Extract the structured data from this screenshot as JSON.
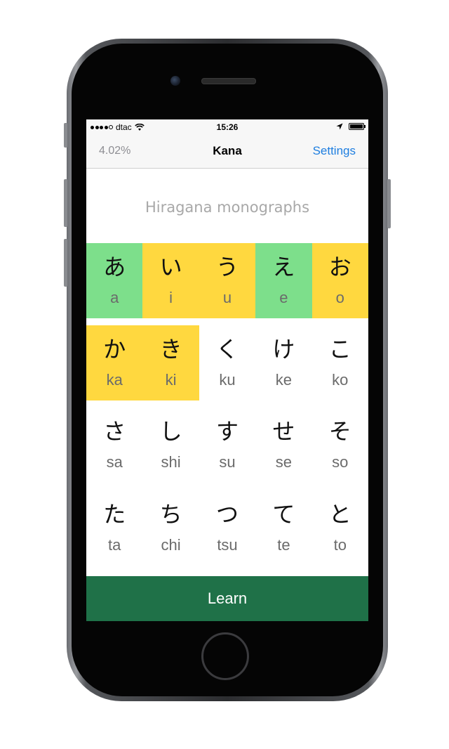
{
  "status_bar": {
    "carrier": "dtac",
    "time": "15:26"
  },
  "nav": {
    "progress": "4.02%",
    "title": "Kana",
    "settings_label": "Settings"
  },
  "section_title": "Hiragana monographs",
  "colors": {
    "known": "#7ddf8b",
    "learning": "#ffd83f",
    "learn_button": "#1f7148",
    "link": "#1e7ee0"
  },
  "rows": [
    [
      {
        "kana": "あ",
        "romaji": "a",
        "state": "green"
      },
      {
        "kana": "い",
        "romaji": "i",
        "state": "yellow"
      },
      {
        "kana": "う",
        "romaji": "u",
        "state": "yellow"
      },
      {
        "kana": "え",
        "romaji": "e",
        "state": "green"
      },
      {
        "kana": "お",
        "romaji": "o",
        "state": "yellow"
      }
    ],
    [
      {
        "kana": "か",
        "romaji": "ka",
        "state": "yellow"
      },
      {
        "kana": "き",
        "romaji": "ki",
        "state": "yellow"
      },
      {
        "kana": "く",
        "romaji": "ku",
        "state": "none"
      },
      {
        "kana": "け",
        "romaji": "ke",
        "state": "none"
      },
      {
        "kana": "こ",
        "romaji": "ko",
        "state": "none"
      }
    ],
    [
      {
        "kana": "さ",
        "romaji": "sa",
        "state": "none"
      },
      {
        "kana": "し",
        "romaji": "shi",
        "state": "none"
      },
      {
        "kana": "す",
        "romaji": "su",
        "state": "none"
      },
      {
        "kana": "せ",
        "romaji": "se",
        "state": "none"
      },
      {
        "kana": "そ",
        "romaji": "so",
        "state": "none"
      }
    ],
    [
      {
        "kana": "た",
        "romaji": "ta",
        "state": "none"
      },
      {
        "kana": "ち",
        "romaji": "chi",
        "state": "none"
      },
      {
        "kana": "つ",
        "romaji": "tsu",
        "state": "none"
      },
      {
        "kana": "て",
        "romaji": "te",
        "state": "none"
      },
      {
        "kana": "と",
        "romaji": "to",
        "state": "none"
      }
    ]
  ],
  "learn_label": "Learn"
}
